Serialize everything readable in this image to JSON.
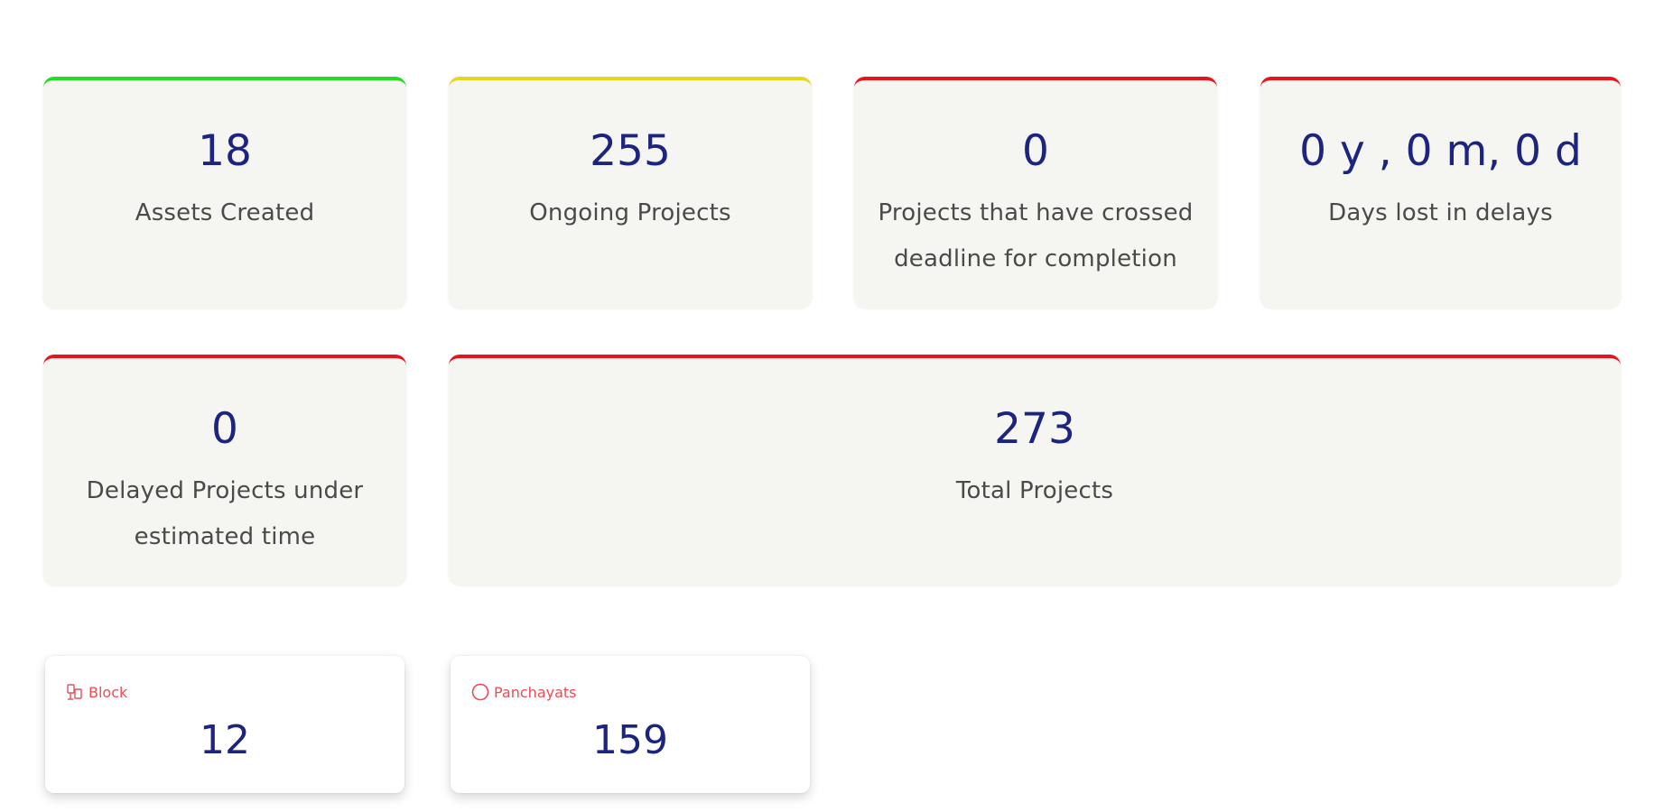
{
  "stats": [
    {
      "value": "18",
      "label": "Assets Created",
      "accent": "#22dd22"
    },
    {
      "value": "255",
      "label": "Ongoing Projects",
      "accent": "#e4d81e"
    },
    {
      "value": "0",
      "label": "Projects that have crossed deadline for completion",
      "accent": "#e8131b"
    },
    {
      "value": "0 y , 0 m, 0 d",
      "label": "Days lost in delays",
      "accent": "#e8131b"
    },
    {
      "value": "0",
      "label": "Delayed Projects under estimated time",
      "accent": "#e8131b"
    },
    {
      "value": "273",
      "label": "Total Projects",
      "accent": "#e8131b"
    }
  ],
  "counts": [
    {
      "label": "Block",
      "value": "12",
      "icon": "block-icon"
    },
    {
      "label": "Panchayats",
      "value": "159",
      "icon": "circle-icon"
    }
  ],
  "colors": {
    "value_text": "#1c2480",
    "label_text": "#4a4a4a",
    "card_background": "#f5f6f1",
    "count_label": "#ef4a55"
  }
}
